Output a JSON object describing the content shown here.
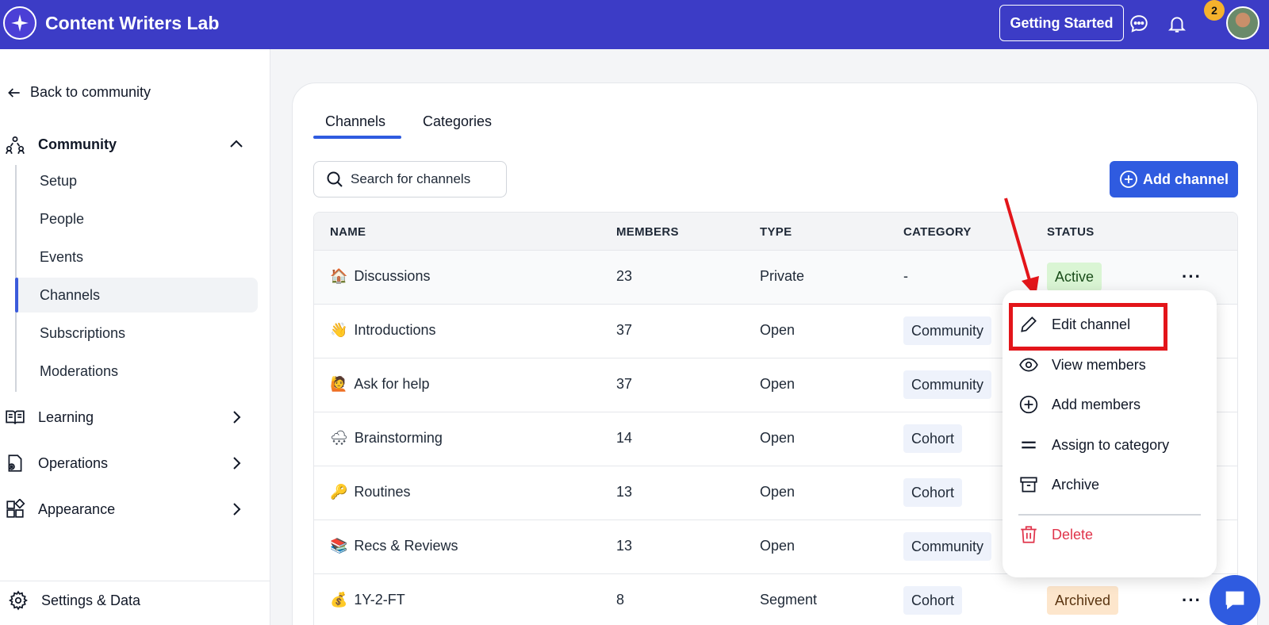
{
  "header": {
    "app_title": "Content Writers Lab",
    "getting_started_label": "Getting Started",
    "notification_count": "2"
  },
  "sidebar": {
    "back_label": "Back to community",
    "community_label": "Community",
    "community_items": [
      {
        "label": "Setup"
      },
      {
        "label": "People"
      },
      {
        "label": "Events"
      },
      {
        "label": "Channels"
      },
      {
        "label": "Subscriptions"
      },
      {
        "label": "Moderations"
      }
    ],
    "active_item": "Channels",
    "sections": [
      {
        "label": "Learning"
      },
      {
        "label": "Operations"
      },
      {
        "label": "Appearance"
      }
    ],
    "settings_label": "Settings & Data"
  },
  "main": {
    "tabs": [
      {
        "label": "Channels"
      },
      {
        "label": "Categories"
      }
    ],
    "active_tab": "Channels",
    "search_placeholder": "Search for channels",
    "add_channel_label": "Add channel",
    "table": {
      "headers": [
        "NAME",
        "MEMBERS",
        "TYPE",
        "CATEGORY",
        "STATUS"
      ],
      "rows": [
        {
          "emoji": "🏠",
          "name": "Discussions",
          "members": "23",
          "type": "Private",
          "category": "-",
          "status": "Active"
        },
        {
          "emoji": "👋",
          "name": "Introductions",
          "members": "37",
          "type": "Open",
          "category": "Community",
          "status": ""
        },
        {
          "emoji": "🙋",
          "name": "Ask for help",
          "members": "37",
          "type": "Open",
          "category": "Community",
          "status": ""
        },
        {
          "emoji": "🌨",
          "name": "Brainstorming",
          "members": "14",
          "type": "Open",
          "category": "Cohort",
          "status": ""
        },
        {
          "emoji": "🔑",
          "name": "Routines",
          "members": "13",
          "type": "Open",
          "category": "Cohort",
          "status": ""
        },
        {
          "emoji": "📚",
          "name": "Recs & Reviews",
          "members": "13",
          "type": "Open",
          "category": "Community",
          "status": ""
        },
        {
          "emoji": "💰",
          "name": "1Y-2-FT",
          "members": "8",
          "type": "Segment",
          "category": "Cohort",
          "status": "Archived"
        }
      ]
    }
  },
  "context_menu": {
    "items": [
      {
        "label": "Edit channel",
        "icon": "pencil-icon"
      },
      {
        "label": "View members",
        "icon": "eye-icon"
      },
      {
        "label": "Add members",
        "icon": "plus-circle-icon"
      },
      {
        "label": "Assign to category",
        "icon": "equals-icon"
      },
      {
        "label": "Archive",
        "icon": "archive-icon"
      },
      {
        "label": "Delete",
        "icon": "trash-icon"
      }
    ]
  },
  "colors": {
    "topbar": "#3c3cc6",
    "primary": "#2f5be0",
    "danger": "#e0344b",
    "annotation_red": "#e3151a",
    "active_badge_bg": "#daf5d4",
    "archived_badge_bg": "#fde6cc"
  }
}
